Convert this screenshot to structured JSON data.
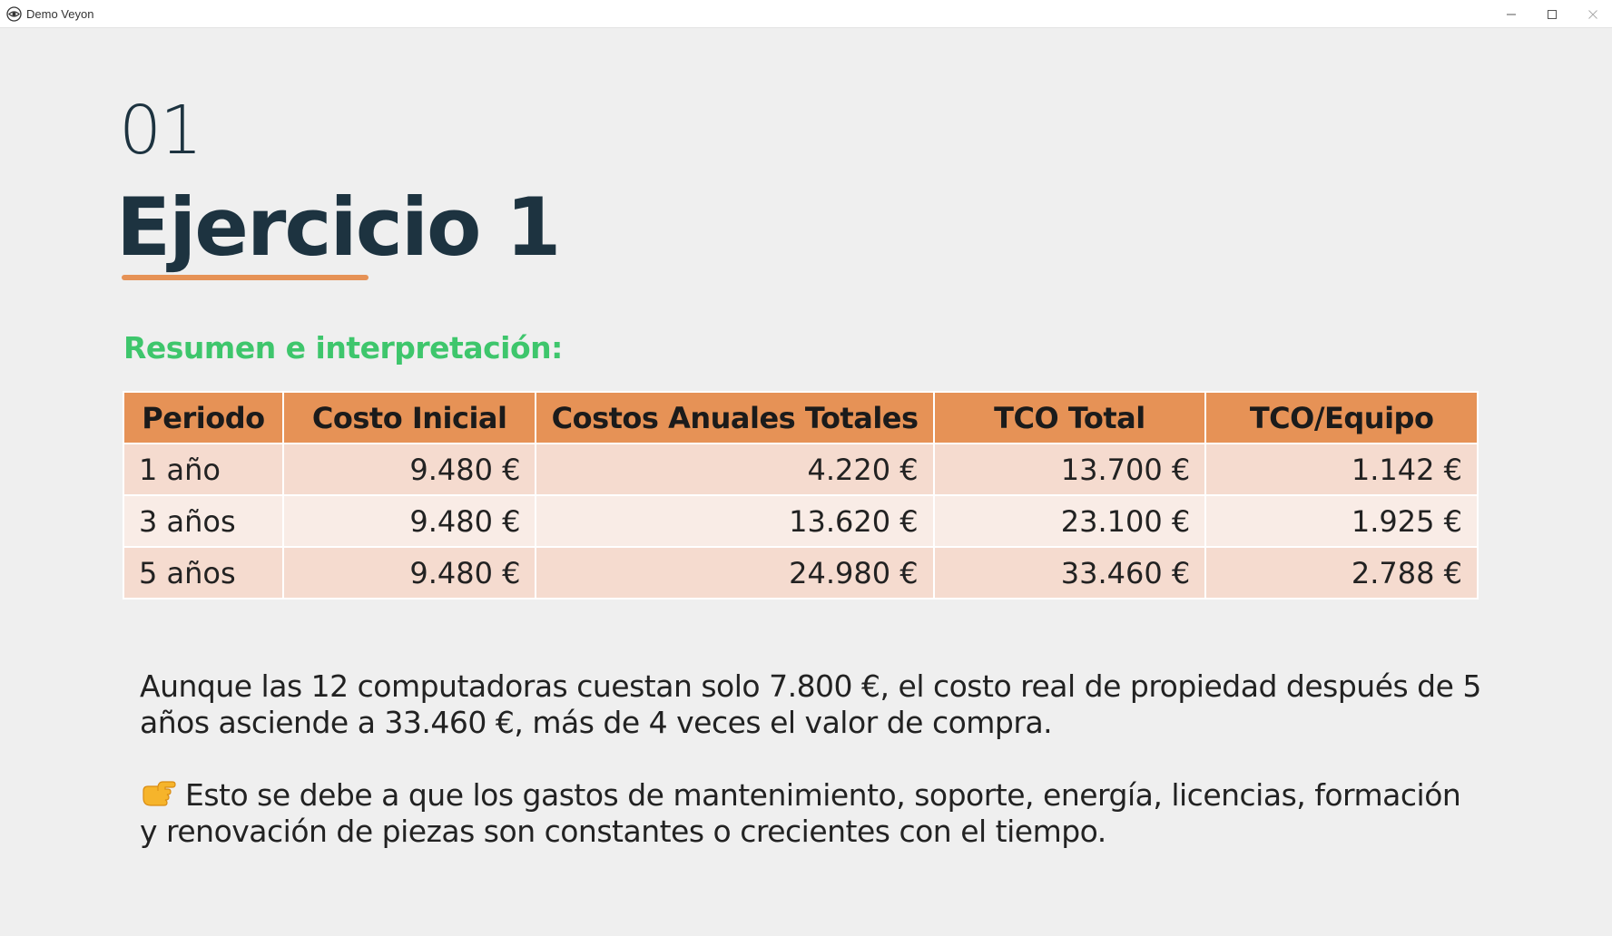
{
  "window": {
    "title": "Demo Veyon",
    "icon": "veyon-eye-icon"
  },
  "slide": {
    "number": "01",
    "title": "Ejercicio 1",
    "section_heading": "Resumen e interpretación:",
    "colors": {
      "title": "#1d3340",
      "accent": "#e69256",
      "heading_green": "#3ec66c",
      "row_odd": "#f5dbcf",
      "row_even": "#f9ece6"
    }
  },
  "table": {
    "headers": [
      "Periodo",
      "Costo Inicial",
      "Costos Anuales Totales",
      "TCO Total",
      "TCO/Equipo"
    ],
    "rows": [
      [
        "1 año",
        "9.480 €",
        "4.220 €",
        "13.700 €",
        "1.142 €"
      ],
      [
        "3 años",
        "9.480 €",
        "13.620 €",
        "23.100 €",
        "1.925 €"
      ],
      [
        "5 años",
        "9.480 €",
        "24.980 €",
        "33.460 €",
        "2.788 €"
      ]
    ]
  },
  "paragraphs": {
    "first": "Aunque las 12 computadoras cuestan solo 7.800 €, el costo real de propiedad después de 5 años asciende a 33.460 €, más de 4 veces el valor de compra.",
    "second_icon": "pointing-right-hand-icon",
    "second": "Esto se debe a que los gastos de mantenimiento, soporte, energía, licencias, formación y renovación de piezas son constantes o crecientes con el tiempo."
  }
}
